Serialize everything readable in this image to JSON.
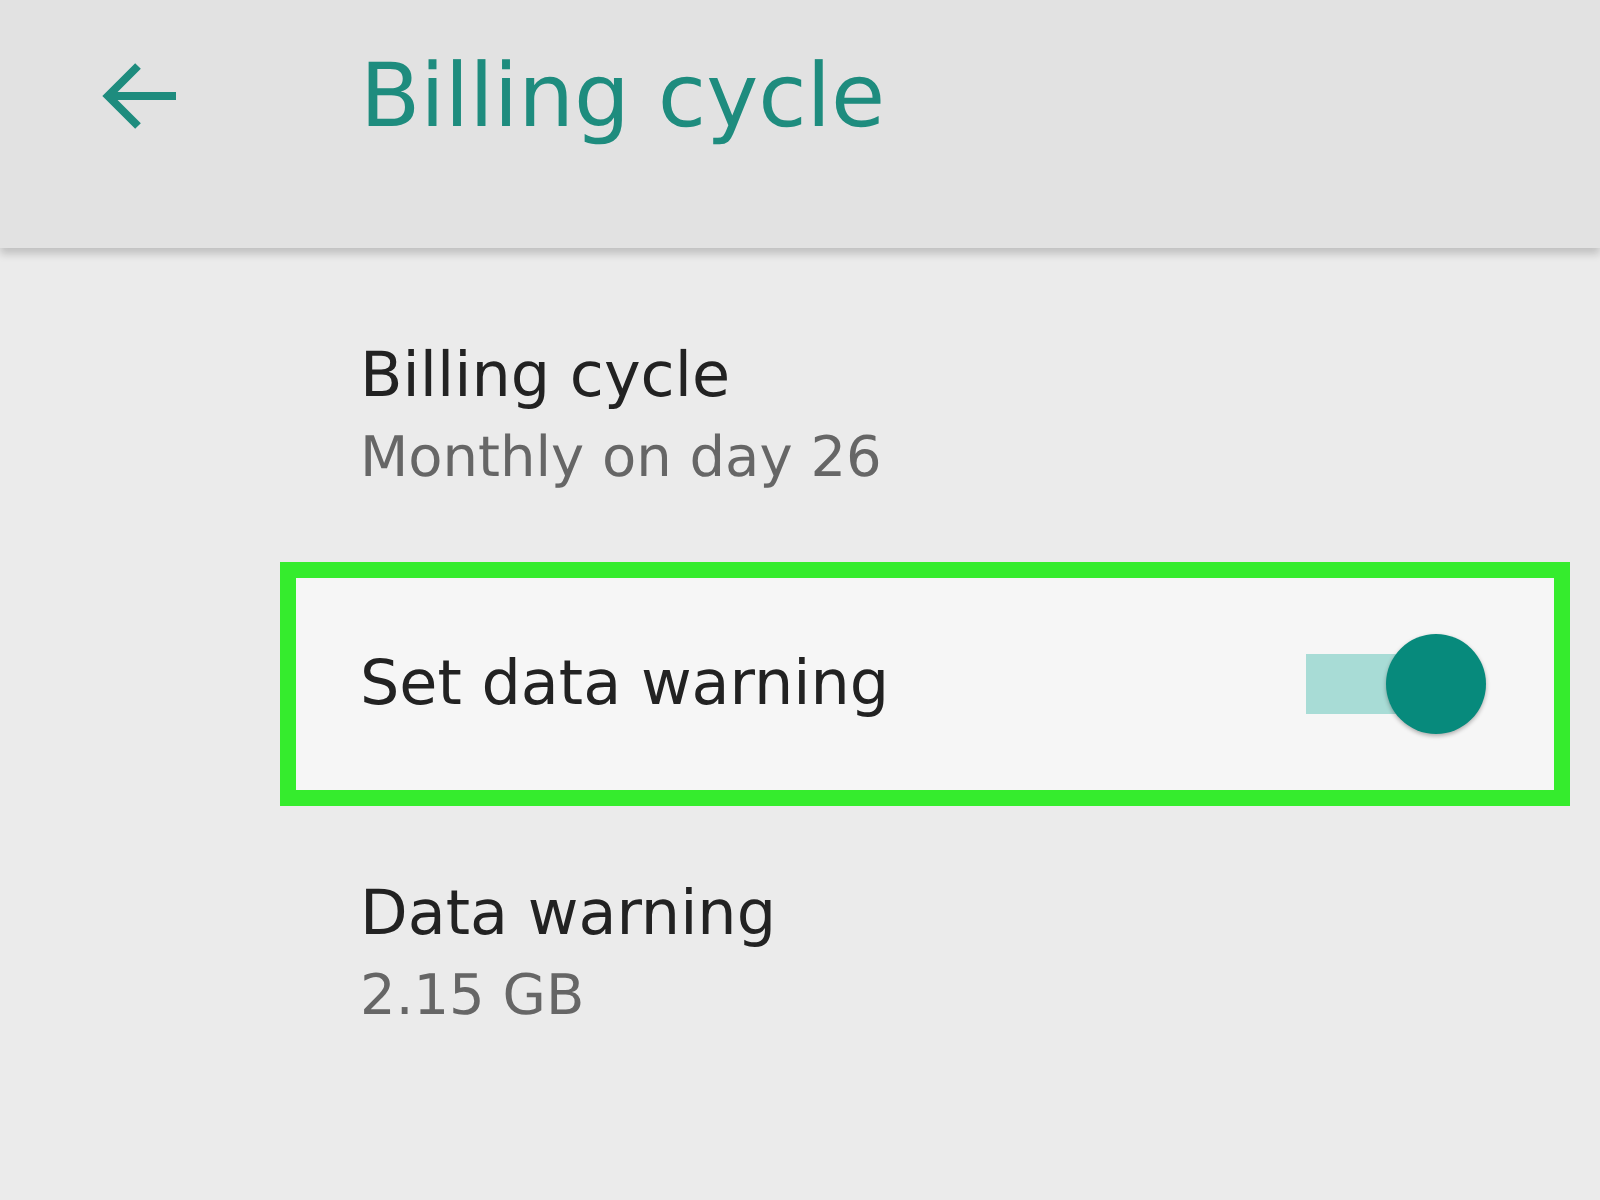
{
  "app_bar": {
    "title": "Billing cycle"
  },
  "settings": [
    {
      "kind": "text",
      "title": "Billing cycle",
      "subtitle": "Monthly on day 26",
      "highlighted": false
    },
    {
      "kind": "switch",
      "title": "Set data warning",
      "on": true,
      "highlighted": true
    },
    {
      "kind": "text",
      "title": "Data warning",
      "subtitle": "2.15 GB",
      "highlighted": false
    }
  ]
}
